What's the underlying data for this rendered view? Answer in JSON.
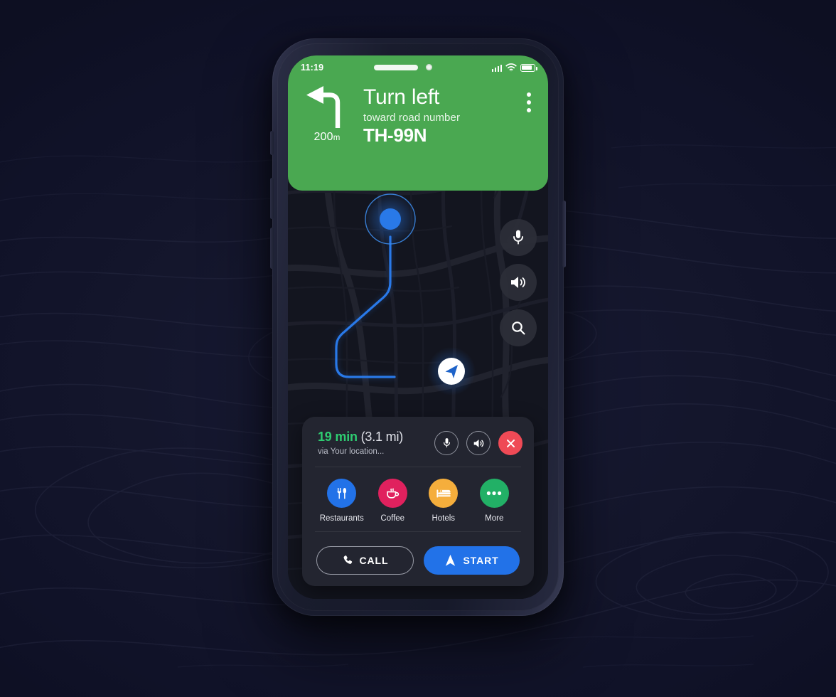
{
  "theme": {
    "green": "#4aa851",
    "blue": "#2272e8",
    "route_blue": "#2979e8",
    "red": "#ef4a56",
    "eta_green": "#2ecc71",
    "card_bg": "#232530",
    "map_bg": "#13151f",
    "page_bg": "#12142a"
  },
  "status_bar": {
    "time": "11:19",
    "signal_icon": "cellular-signal-icon",
    "wifi_icon": "wifi-icon",
    "battery_icon": "battery-icon",
    "battery_level": 70
  },
  "nav_header": {
    "maneuver_icon": "turn-left-arrow-icon",
    "distance_value": "200",
    "distance_unit": "m",
    "instruction": "Turn left",
    "subtitle": "toward road number",
    "road": "TH-99N",
    "overflow_icon": "kebab-menu-icon"
  },
  "map": {
    "origin_marker": "origin-dot-marker",
    "destination_marker": "navigation-arrow-marker",
    "controls": [
      {
        "name": "microphone-button",
        "icon": "microphone-icon"
      },
      {
        "name": "volume-button",
        "icon": "speaker-icon"
      },
      {
        "name": "search-button",
        "icon": "search-icon"
      }
    ]
  },
  "card": {
    "eta_minutes": "19 min",
    "eta_distance": "(3.1 mi)",
    "via_text": "via Your location...",
    "round_buttons": [
      {
        "name": "mic-toggle",
        "icon": "microphone-icon"
      },
      {
        "name": "sound-toggle",
        "icon": "speaker-icon"
      },
      {
        "name": "close-route",
        "icon": "close-x-icon"
      }
    ],
    "categories": [
      {
        "label": "Restaurants",
        "icon": "cutlery-icon",
        "color": "#2272e8"
      },
      {
        "label": "Coffee",
        "icon": "coffee-cup-icon",
        "color": "#e0215e"
      },
      {
        "label": "Hotels",
        "icon": "bed-icon",
        "color": "#f5ae3c"
      },
      {
        "label": "More",
        "icon": "ellipsis-icon",
        "color": "#22b066"
      }
    ],
    "call_label": "CALL",
    "call_icon": "phone-icon",
    "start_label": "START",
    "start_icon": "navigation-arrow-icon"
  }
}
